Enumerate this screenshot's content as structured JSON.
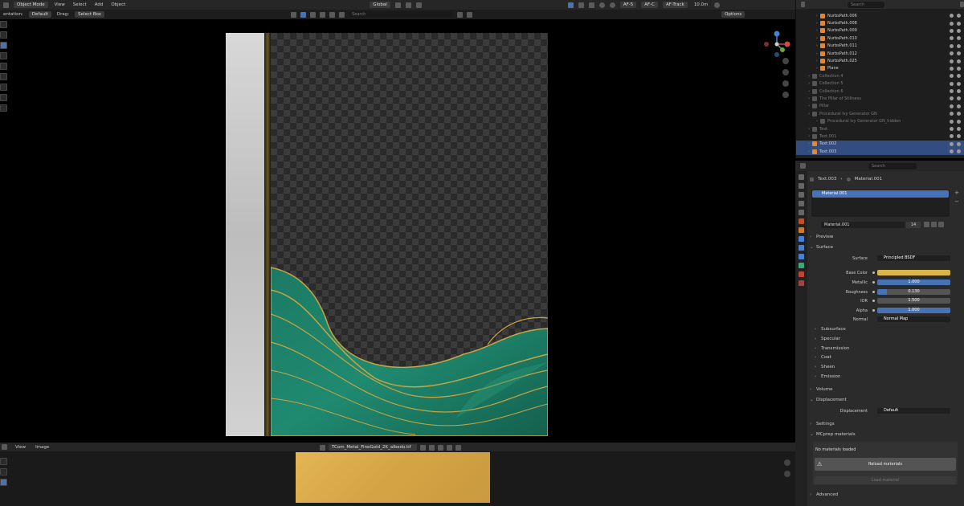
{
  "top_menu": {
    "mode": "Object Mode",
    "items": [
      "View",
      "Select",
      "Add",
      "Object"
    ],
    "transform_space": "Global",
    "af_labels": [
      "AF-5",
      "AF-C",
      "AF-Track"
    ],
    "clip": "10.0m"
  },
  "toolbar": {
    "orientation_label": "entation:",
    "orientation_value": "Default",
    "drag_label": "Drag:",
    "drag_value": "Select Box",
    "search_placeholder": "Search",
    "options_label": "Options"
  },
  "outliner": {
    "search_placeholder": "Search",
    "rows": [
      {
        "label": "NurbsPath.006",
        "indent": 1,
        "style": "normal"
      },
      {
        "label": "NurbsPath.008",
        "indent": 1,
        "style": "normal"
      },
      {
        "label": "NurbsPath.009",
        "indent": 1,
        "style": "normal"
      },
      {
        "label": "NurbsPath.010",
        "indent": 1,
        "style": "normal"
      },
      {
        "label": "NurbsPath.011",
        "indent": 1,
        "style": "normal"
      },
      {
        "label": "NurbsPath.012",
        "indent": 1,
        "style": "normal"
      },
      {
        "label": "NurbsPath.025",
        "indent": 1,
        "style": "normal"
      },
      {
        "label": "Plane",
        "indent": 1,
        "style": "normal"
      },
      {
        "label": "Collection 4",
        "indent": 0,
        "style": "dim"
      },
      {
        "label": "Collection 5",
        "indent": 0,
        "style": "dim"
      },
      {
        "label": "Collection 6",
        "indent": 0,
        "style": "dim"
      },
      {
        "label": "The Pillar of Stillness",
        "indent": 0,
        "style": "dim"
      },
      {
        "label": "Pillar",
        "indent": 0,
        "style": "dim"
      },
      {
        "label": "Procedural Ivy Generator GN",
        "indent": 0,
        "style": "dim"
      },
      {
        "label": "Procedural Ivy Generator GN_hidden",
        "indent": 1,
        "style": "dim"
      },
      {
        "label": "Text",
        "indent": 0,
        "style": "dim"
      },
      {
        "label": "Text.001",
        "indent": 0,
        "style": "dim"
      },
      {
        "label": "Text.002",
        "indent": 0,
        "style": "sel"
      },
      {
        "label": "Text.003",
        "indent": 0,
        "style": "sel"
      }
    ]
  },
  "properties": {
    "search_placeholder": "Search",
    "breadcrumb_object": "Text.003",
    "breadcrumb_material": "Material.001",
    "slot_name": "Material.001",
    "material_name": "Material.001",
    "users": "14",
    "panels": {
      "preview": "Preview",
      "surface": "Surface",
      "volume": "Volume",
      "displacement": "Displacement",
      "settings": "Settings",
      "mcprep": "MCprep materials",
      "advanced": "Advanced"
    },
    "surface_label": "Surface",
    "surface_value": "Principled BSDF",
    "fields": [
      {
        "label": "Base Color",
        "value": "",
        "fill": 1.0,
        "kind": "color"
      },
      {
        "label": "Metallic",
        "value": "1.000",
        "fill": 1.0,
        "kind": "slider"
      },
      {
        "label": "Roughness",
        "value": "0.130",
        "fill": 0.13,
        "kind": "slider"
      },
      {
        "label": "IOR",
        "value": "1.500",
        "fill": 0.0,
        "kind": "slider"
      },
      {
        "label": "Alpha",
        "value": "1.000",
        "fill": 1.0,
        "kind": "slider"
      }
    ],
    "normal_label": "Normal",
    "normal_value": "Normal Map",
    "subpanels": [
      "Subsurface",
      "Specular",
      "Transmission",
      "Coat",
      "Sheen",
      "Emission"
    ],
    "displacement_label": "Displacement",
    "displacement_value": "Default",
    "mcprep_status": "No materials loaded",
    "reload_label": "Reload materials",
    "load_label": "Load material"
  },
  "image_editor": {
    "menu": [
      "View",
      "Image"
    ],
    "image_name": "TCom_Metal_FineGold_2K_albedo.tif"
  },
  "colors": {
    "accent": "#4772b3",
    "base_color": "#d9b54a",
    "teal": "#1e7a63",
    "gold": "#c9a441"
  }
}
